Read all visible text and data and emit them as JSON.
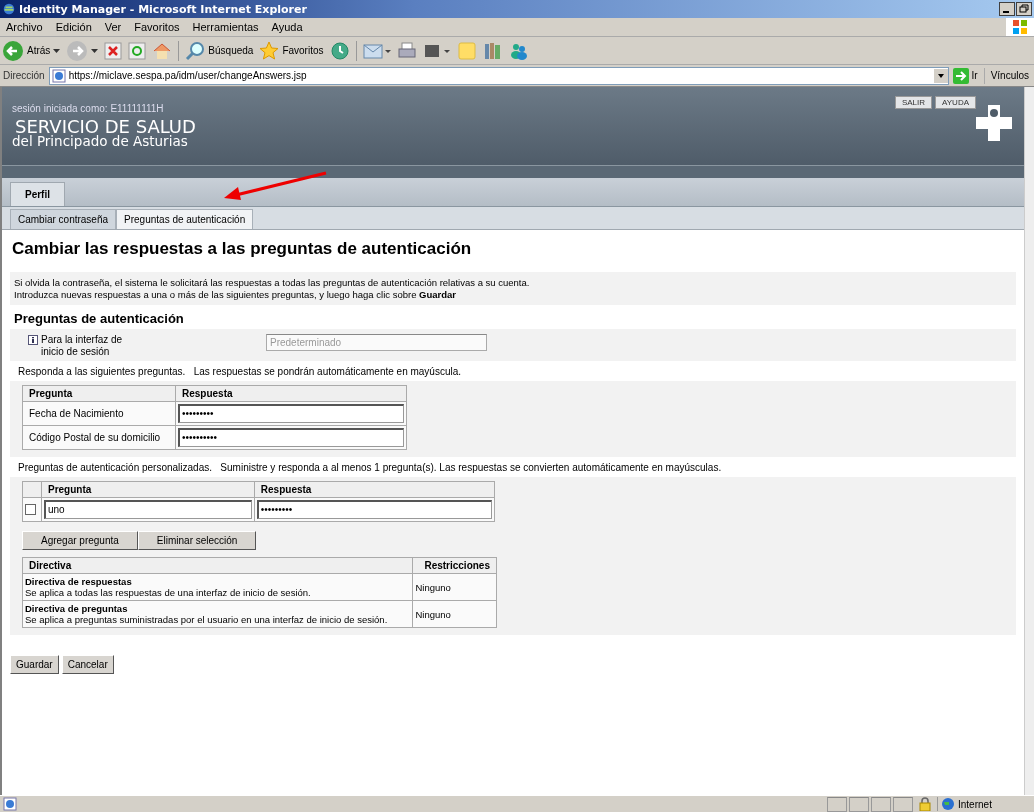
{
  "window": {
    "title": "Identity Manager - Microsoft Internet Explorer"
  },
  "menu": [
    "Archivo",
    "Edición",
    "Ver",
    "Favoritos",
    "Herramientas",
    "Ayuda"
  ],
  "toolbar": {
    "back": "Atrás",
    "search": "Búsqueda",
    "favorites": "Favoritos"
  },
  "address": {
    "label": "Dirección",
    "url": "https://miclave.sespa.pa/idm/user/changeAnswers.jsp",
    "go": "Ir",
    "links": "Vínculos"
  },
  "header": {
    "session": "sesión iniciada como: E11111111H",
    "org_line1": "SERVICIO DE SALUD",
    "org_line2": "del Principado de Asturias",
    "buttons": [
      "SALIR",
      "AYUDA"
    ]
  },
  "tabs": [
    {
      "label": "Perfil",
      "selected": true
    }
  ],
  "subtabs": [
    {
      "label": "Cambiar contraseña",
      "selected": false
    },
    {
      "label": "Preguntas de autenticación",
      "selected": true
    }
  ],
  "heading": "Cambiar las respuestas a las preguntas de autenticación",
  "intro": [
    "Si olvida la contraseña, el sistema le solicitará las respuestas a todas las preguntas de autenticación relativas a su cuenta.",
    "Introduzca nuevas respuestas a una o más de las siguientes preguntas, y luego haga clic sobre **Guardar**"
  ],
  "section_title": "Preguntas de autenticación",
  "interface": {
    "label": "Para la interfaz de inicio de sesión",
    "value": "Predeterminado",
    "disabled": true
  },
  "note1": "Responda a las siguientes preguntas.   Las respuestas se pondrán automáticamente en mayúscula.",
  "questions": {
    "columns": [
      "Pregunta",
      "Respuesta"
    ],
    "rows": [
      {
        "question": "Fecha de Nacimiento",
        "answer": "•••••••••"
      },
      {
        "question": "Código Postal de su domicilio",
        "answer": "••••••••••"
      }
    ]
  },
  "note2": "Preguntas de autenticación personalizadas.   Suministre y responda a al menos 1 pregunta(s). Las respuestas se convierten automáticamente en mayúsculas.",
  "custom": {
    "columns": [
      "Pregunta",
      "Respuesta"
    ],
    "rows": [
      {
        "checked": false,
        "question": "uno",
        "answer": "•••••••••"
      }
    ]
  },
  "custom_buttons": [
    "Agregar pregunta",
    "Eliminar selección"
  ],
  "policies": {
    "columns": [
      "Directiva",
      "Restricciones"
    ],
    "rows": [
      {
        "name": "Directiva de respuestas",
        "description": "Se aplica a todas las respuestas de una interfaz de inicio de sesión.",
        "restriction": "Ninguno"
      },
      {
        "name": "Directiva de preguntas",
        "description": "Se aplica a preguntas suministradas por el usuario en una interfaz de inicio de sesión.",
        "restriction": "Ninguno"
      }
    ]
  },
  "form_buttons": [
    "Guardar",
    "Cancelar"
  ],
  "status_bar": {
    "zone": "Internet"
  }
}
